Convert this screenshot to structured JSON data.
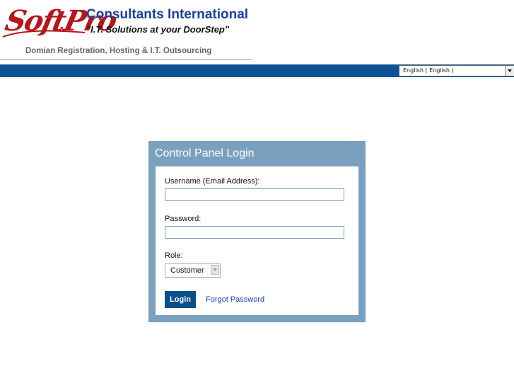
{
  "header": {
    "logo_text": "SoftPro",
    "company_name": "Consultants International",
    "tagline": "\"I.T. Solutions at your DoorStep\"",
    "services": "Domian Registration, Hosting & I.T. Outsourcing"
  },
  "topbar": {
    "language_selected": "English ( English )"
  },
  "login": {
    "title": "Control Panel Login",
    "username_label": "Username (Email Address):",
    "username_value": "",
    "password_label": "Password:",
    "password_value": "",
    "role_label": "Role:",
    "role_selected": "Customer",
    "login_button": "Login",
    "forgot_password": "Forgot Password"
  },
  "colors": {
    "brand_red": "#b5161b",
    "brand_blue": "#1f3f9c",
    "topbar_blue": "#0b5394",
    "panel_blue": "#7aa0c0",
    "button_blue": "#0b4f8a"
  }
}
